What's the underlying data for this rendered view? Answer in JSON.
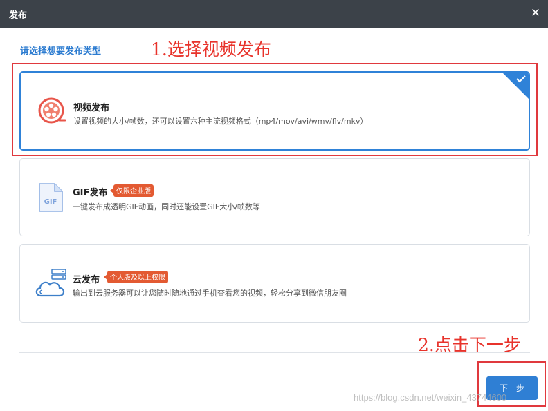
{
  "dialog": {
    "title": "发布",
    "prompt": "请选择想要发布类型"
  },
  "annotations": {
    "step1": "1.选择视频发布",
    "step2": "2.点击下一步"
  },
  "options": [
    {
      "name": "视频发布",
      "description": "设置视频的大小/帧数，还可以设置六种主流视频格式（mp4/mov/avi/wmv/flv/mkv）",
      "icon": "film-reel-icon",
      "selected": true
    },
    {
      "name": "GIF发布",
      "badge": "仅限企业版",
      "description": "一键发布成透明GIF动画，同时还能设置GIF大小/帧数等",
      "icon": "gif-file-icon",
      "icon_text": "GIF",
      "selected": false
    },
    {
      "name": "云发布",
      "badge": "个人版及以上权限",
      "description": "输出到云服务器可以让您随时随地通过手机查看您的视频，轻松分享到微信朋友圈",
      "icon": "cloud-server-icon",
      "selected": false
    }
  ],
  "footer": {
    "next_label": "下一步"
  },
  "watermark": "https://blog.csdn.net/weixin_43744600",
  "colors": {
    "titlebar": "#3c4249",
    "accent": "#2f82d8",
    "badge": "#e35a32",
    "annotation": "#e8332b"
  }
}
